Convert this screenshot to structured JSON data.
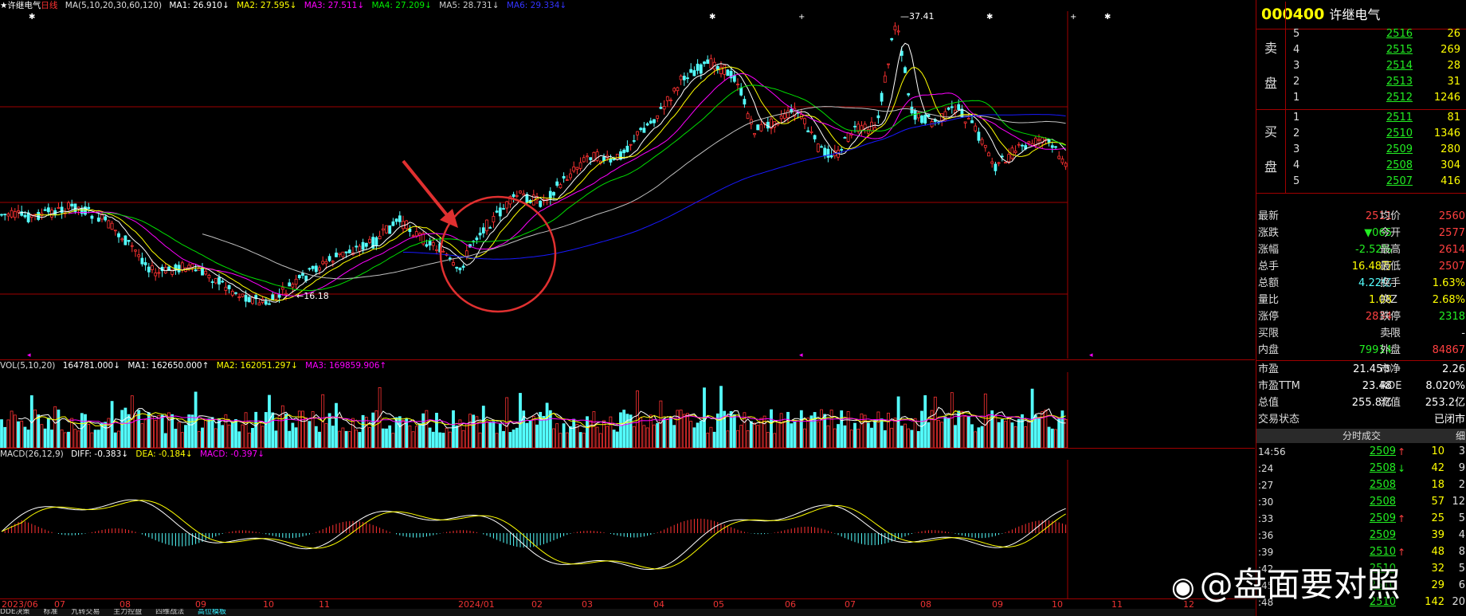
{
  "colors": {
    "up": "#ff3232",
    "down": "#54ffff",
    "ma1": "#ffffff",
    "ma2": "#ffff00",
    "ma3": "#ff00ff",
    "ma4": "#00e000",
    "ma5": "#c0c0c0",
    "ma6": "#1818ff",
    "grid": "#a00000",
    "green": "#22ee22",
    "red": "#ff4040"
  },
  "main": {
    "legend": {
      "star": "★",
      "name": "许继电气",
      "period": "日线",
      "ma_label": "MA(5,10,20,30,60,120)",
      "ma1": "MA1: 26.910↓",
      "ma2": "MA2: 27.595↓",
      "ma3": "MA3: 27.511↓",
      "ma4": "MA4: 27.209↓",
      "ma5": "MA5: 28.731↓",
      "ma6": "MA6: 29.334↓"
    },
    "high_label": "37.41",
    "low_label": "16.18"
  },
  "volume": {
    "legend": {
      "name": "VOL(5,10,20)",
      "vol": "164781.000↓",
      "ma1": "MA1: 162650.000↑",
      "ma2": "MA2: 162051.297↓",
      "ma3": "MA3: 169859.906↑"
    }
  },
  "macd": {
    "legend": {
      "name": "MACD(26,12,9)",
      "diff": "DIFF: -0.383↓",
      "dea": "DEA: -0.184↓",
      "macd": "MACD: -0.397↓"
    }
  },
  "xaxis": [
    "2023/06",
    "07",
    "08",
    "09",
    "10",
    "11",
    "2024/01",
    "02",
    "03",
    "04",
    "05",
    "06",
    "07",
    "08",
    "09",
    "10",
    "11",
    "12"
  ],
  "tabs": [
    "DDE决策",
    "标准",
    "九转交易",
    "主力控盘",
    "四维战法",
    "高位模板"
  ],
  "quote": {
    "code": "000400",
    "name": "许继电气",
    "sell_label": [
      "卖",
      "盘"
    ],
    "buy_label": [
      "买",
      "盘"
    ],
    "sell": [
      {
        "lvl": "5",
        "price": "2516",
        "qty": "26"
      },
      {
        "lvl": "4",
        "price": "2515",
        "qty": "269"
      },
      {
        "lvl": "3",
        "price": "2514",
        "qty": "28"
      },
      {
        "lvl": "2",
        "price": "2513",
        "qty": "31"
      },
      {
        "lvl": "1",
        "price": "2512",
        "qty": "1246"
      }
    ],
    "buy": [
      {
        "lvl": "1",
        "price": "2511",
        "qty": "81"
      },
      {
        "lvl": "2",
        "price": "2510",
        "qty": "1346"
      },
      {
        "lvl": "3",
        "price": "2509",
        "qty": "280"
      },
      {
        "lvl": "4",
        "price": "2508",
        "qty": "304"
      },
      {
        "lvl": "5",
        "price": "2507",
        "qty": "416"
      }
    ],
    "stats": [
      {
        "l": "最新",
        "lv": "2511",
        "lc": "#ff4040",
        "r": "均价",
        "rv": "2560",
        "rc": "#ff4040"
      },
      {
        "l": "涨跌",
        "lv": "▼065",
        "lc": "#22ee22",
        "r": "今开",
        "rv": "2577",
        "rc": "#ff4040"
      },
      {
        "l": "涨幅",
        "lv": "-2.52%",
        "lc": "#22ee22",
        "r": "最高",
        "rv": "2614",
        "rc": "#ff4040"
      },
      {
        "l": "总手",
        "lv": "16.48万",
        "lc": "#ffff00",
        "r": "最低",
        "rv": "2507",
        "rc": "#ff4040"
      },
      {
        "l": "总额",
        "lv": "4.22亿",
        "lc": "#54ffff",
        "r": "换手",
        "rv": "1.63%",
        "rc": "#ffff00"
      },
      {
        "l": "量比",
        "lv": "1.08",
        "lc": "#ffff00",
        "r": "换Z",
        "rv": "2.68%",
        "rc": "#ffff00"
      },
      {
        "l": "涨停",
        "lv": "2834",
        "lc": "#ff4040",
        "r": "跌停",
        "rv": "2318",
        "rc": "#22ee22"
      },
      {
        "l": "买限",
        "lv": "-",
        "lc": "#ddd",
        "r": "卖限",
        "rv": "-",
        "rc": "#ddd"
      },
      {
        "l": "内盘",
        "lv": "79914",
        "lc": "#22ee22",
        "r": "外盘",
        "rv": "84867",
        "rc": "#ff4040"
      }
    ],
    "info": [
      {
        "l": "市盈",
        "lv": "21.45③",
        "r": "市净",
        "rv": "2.26"
      },
      {
        "l": "市盈TTM",
        "lv": "23.48",
        "r": "ROE",
        "rv": "8.020%"
      },
      {
        "l": "总值",
        "lv": "255.8亿",
        "r": "流值",
        "rv": "253.2亿"
      },
      {
        "l": "交易状态",
        "lv": "",
        "r": "",
        "rv": "已闭市"
      }
    ],
    "trades_header": "分时成交",
    "trades_side": "细",
    "trades": [
      {
        "t": "14:56",
        "p": "2509",
        "a": "↑",
        "ac": "#ff4040",
        "v": "10",
        "n": "3"
      },
      {
        "t": ":24",
        "p": "2508",
        "a": "↓",
        "ac": "#22ee22",
        "v": "42",
        "n": "9"
      },
      {
        "t": ":27",
        "p": "2508",
        "a": "",
        "ac": "",
        "v": "18",
        "n": "2"
      },
      {
        "t": ":30",
        "p": "2508",
        "a": "",
        "ac": "",
        "v": "57",
        "n": "12"
      },
      {
        "t": ":33",
        "p": "2509",
        "a": "↑",
        "ac": "#ff4040",
        "v": "25",
        "n": "5"
      },
      {
        "t": ":36",
        "p": "2509",
        "a": "",
        "ac": "",
        "v": "39",
        "n": "4"
      },
      {
        "t": ":39",
        "p": "2510",
        "a": "↑",
        "ac": "#ff4040",
        "v": "48",
        "n": "8"
      },
      {
        "t": ":42",
        "p": "2510",
        "a": "",
        "ac": "",
        "v": "32",
        "n": "5"
      },
      {
        "t": ":45",
        "p": "2510",
        "a": "",
        "ac": "",
        "v": "29",
        "n": "6"
      },
      {
        "t": ":48",
        "p": "2510",
        "a": "",
        "ac": "",
        "v": "142",
        "n": "20"
      }
    ]
  },
  "watermark": "@盘面要对照"
}
